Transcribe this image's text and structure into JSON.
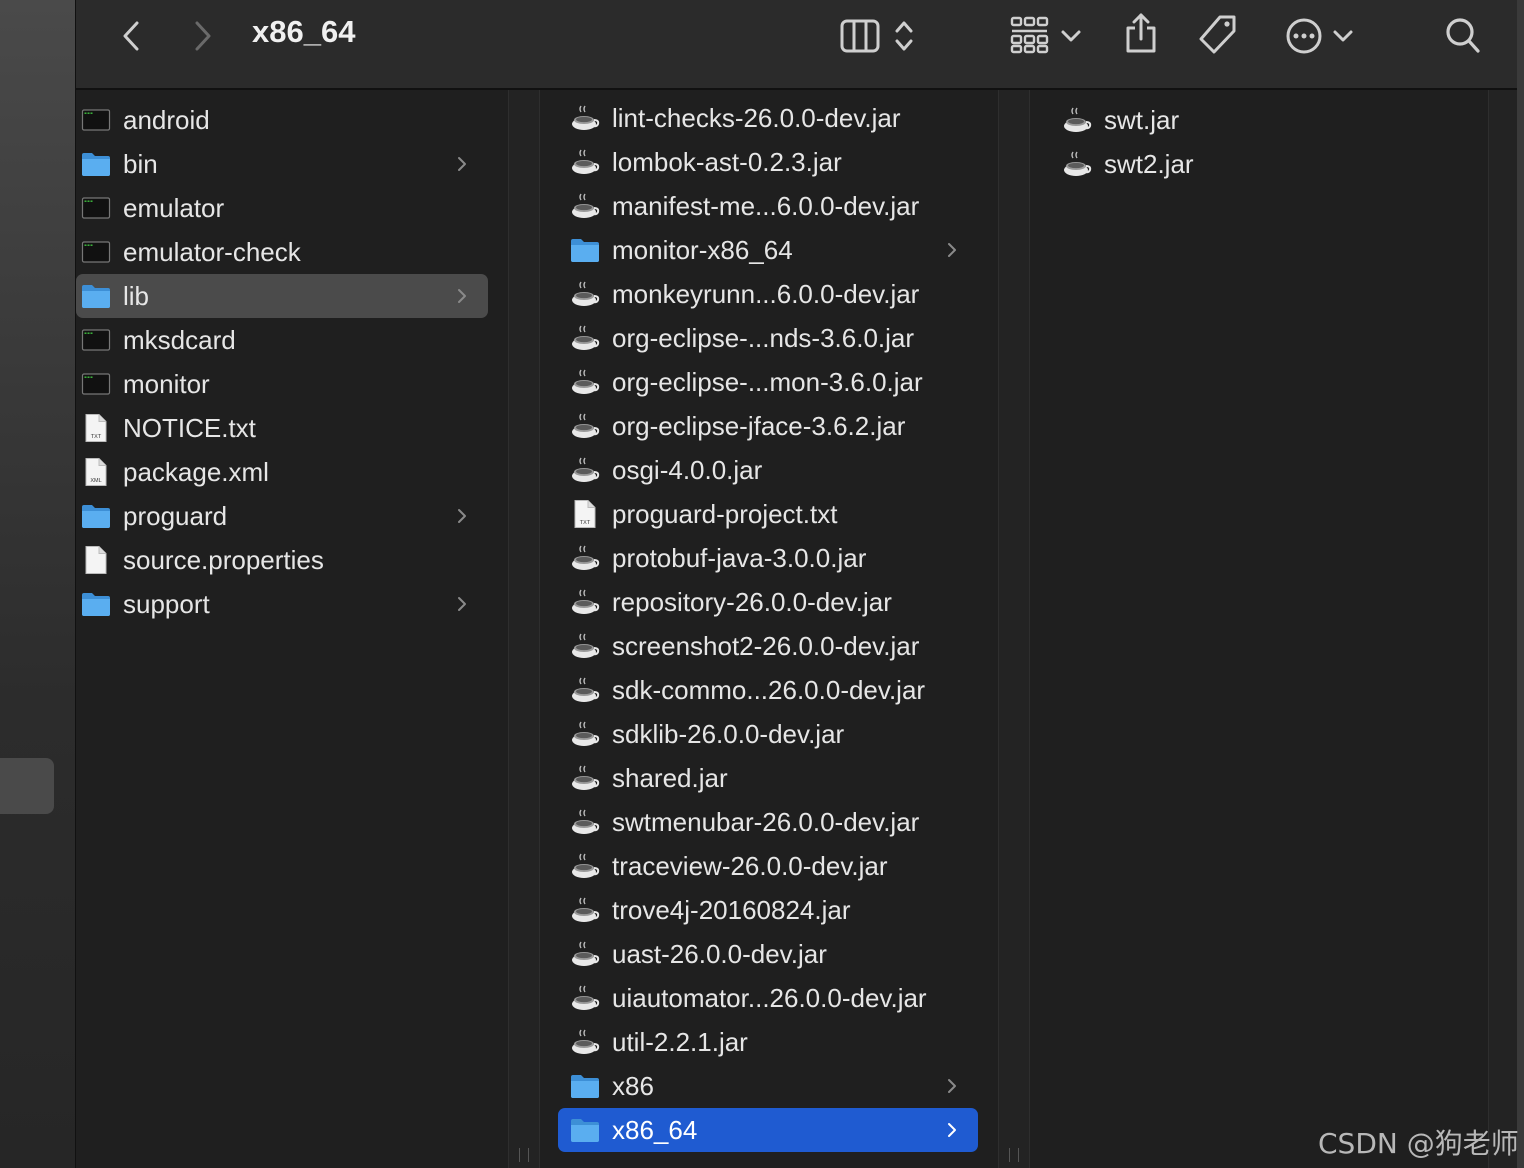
{
  "toolbar": {
    "title": "x86_64",
    "icons": [
      "back-chevron-icon",
      "forward-chevron-icon",
      "column-view-icon",
      "sort-arrows-icon",
      "group-grid-icon",
      "chevron-down-icon",
      "share-icon",
      "tag-icon",
      "more-ellipsis-icon",
      "search-icon"
    ]
  },
  "column1": {
    "items": [
      {
        "label": "android",
        "icon": "exec-icon"
      },
      {
        "label": "bin",
        "icon": "folder-icon",
        "folder": true
      },
      {
        "label": "emulator",
        "icon": "exec-icon"
      },
      {
        "label": "emulator-check",
        "icon": "exec-icon"
      },
      {
        "label": "lib",
        "icon": "folder-icon",
        "folder": true,
        "selected": true
      },
      {
        "label": "mksdcard",
        "icon": "exec-icon"
      },
      {
        "label": "monitor",
        "icon": "exec-icon"
      },
      {
        "label": "NOTICE.txt",
        "icon": "txt-file-icon",
        "badge": "TXT"
      },
      {
        "label": "package.xml",
        "icon": "xml-file-icon",
        "badge": "XML"
      },
      {
        "label": "proguard",
        "icon": "folder-icon",
        "folder": true
      },
      {
        "label": "source.properties",
        "icon": "blank-file-icon"
      },
      {
        "label": "support",
        "icon": "folder-icon",
        "folder": true
      }
    ]
  },
  "column2": {
    "items": [
      {
        "label": "lint-checks-26.0.0-dev.jar",
        "icon": "jar-icon"
      },
      {
        "label": "lombok-ast-0.2.3.jar",
        "icon": "jar-icon"
      },
      {
        "label": "manifest-me...6.0.0-dev.jar",
        "icon": "jar-icon"
      },
      {
        "label": "monitor-x86_64",
        "icon": "folder-icon",
        "folder": true
      },
      {
        "label": "monkeyrunn...6.0.0-dev.jar",
        "icon": "jar-icon"
      },
      {
        "label": "org-eclipse-...nds-3.6.0.jar",
        "icon": "jar-icon"
      },
      {
        "label": "org-eclipse-...mon-3.6.0.jar",
        "icon": "jar-icon"
      },
      {
        "label": "org-eclipse-jface-3.6.2.jar",
        "icon": "jar-icon"
      },
      {
        "label": "osgi-4.0.0.jar",
        "icon": "jar-icon"
      },
      {
        "label": "proguard-project.txt",
        "icon": "txt-file-icon",
        "badge": "TXT"
      },
      {
        "label": "protobuf-java-3.0.0.jar",
        "icon": "jar-icon"
      },
      {
        "label": "repository-26.0.0-dev.jar",
        "icon": "jar-icon"
      },
      {
        "label": "screenshot2-26.0.0-dev.jar",
        "icon": "jar-icon"
      },
      {
        "label": "sdk-commo...26.0.0-dev.jar",
        "icon": "jar-icon"
      },
      {
        "label": "sdklib-26.0.0-dev.jar",
        "icon": "jar-icon"
      },
      {
        "label": "shared.jar",
        "icon": "jar-icon"
      },
      {
        "label": "swtmenubar-26.0.0-dev.jar",
        "icon": "jar-icon"
      },
      {
        "label": "traceview-26.0.0-dev.jar",
        "icon": "jar-icon"
      },
      {
        "label": "trove4j-20160824.jar",
        "icon": "jar-icon"
      },
      {
        "label": "uast-26.0.0-dev.jar",
        "icon": "jar-icon"
      },
      {
        "label": "uiautomator...26.0.0-dev.jar",
        "icon": "jar-icon"
      },
      {
        "label": "util-2.2.1.jar",
        "icon": "jar-icon"
      },
      {
        "label": "x86",
        "icon": "folder-icon",
        "folder": true
      },
      {
        "label": "x86_64",
        "icon": "folder-icon",
        "folder": true,
        "selected": true
      }
    ]
  },
  "column3": {
    "items": [
      {
        "label": "swt.jar",
        "icon": "jar-icon"
      },
      {
        "label": "swt2.jar",
        "icon": "jar-icon"
      }
    ]
  },
  "watermark": "CSDN @狗老师",
  "colors": {
    "selected_blue": "#1f5bd1",
    "selected_gray": "#4b4b4b",
    "folder": "#5aaef0"
  }
}
